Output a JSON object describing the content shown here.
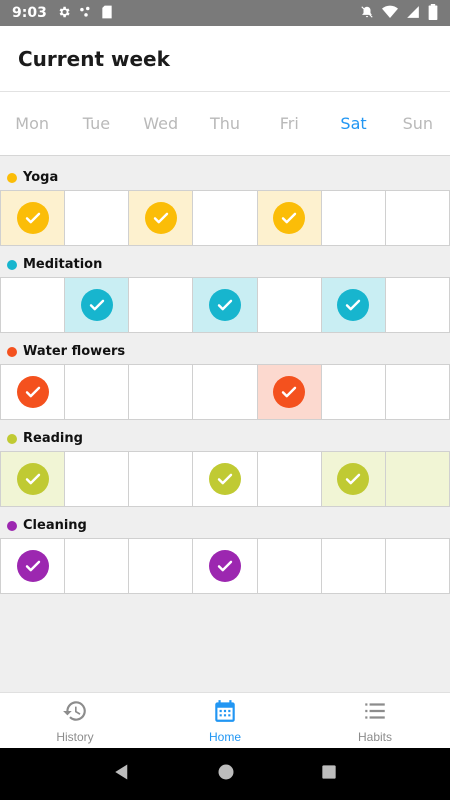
{
  "status_bar": {
    "time": "9:03"
  },
  "app_bar": {
    "title": "Current week"
  },
  "week": {
    "today_index": 5,
    "days": [
      "Mon",
      "Tue",
      "Wed",
      "Thu",
      "Fri",
      "Sat",
      "Sun"
    ]
  },
  "habits": [
    {
      "name": "Yoga",
      "color": "#fbbd08",
      "tint": "#fdf1cf",
      "checked": [
        true,
        false,
        true,
        false,
        true,
        false,
        false
      ]
    },
    {
      "name": "Meditation",
      "color": "#17b5ce",
      "tint": "#c9eef3",
      "checked": [
        false,
        true,
        false,
        true,
        false,
        true,
        false
      ]
    },
    {
      "name": "Water flowers",
      "color": "#f4511e",
      "tint": "#fcd9cf",
      "checked": [
        true,
        false,
        false,
        false,
        true,
        false,
        false
      ],
      "tinted_cells": [
        4
      ]
    },
    {
      "name": "Reading",
      "color": "#c0ca33",
      "tint": "#f1f5d5",
      "checked": [
        true,
        false,
        false,
        true,
        false,
        true,
        false
      ],
      "tinted_cells": [
        0,
        5,
        6
      ]
    },
    {
      "name": "Cleaning",
      "color": "#9c27b0",
      "tint": "#efdbf3",
      "checked": [
        true,
        false,
        false,
        true,
        false,
        false,
        false
      ],
      "tinted_cells": []
    }
  ],
  "bottom_nav": {
    "active": 1,
    "items": [
      {
        "label": "History",
        "icon": "history-icon"
      },
      {
        "label": "Home",
        "icon": "calendar-icon"
      },
      {
        "label": "Habits",
        "icon": "list-icon"
      }
    ]
  },
  "colors": {
    "accent": "#2196f3"
  }
}
